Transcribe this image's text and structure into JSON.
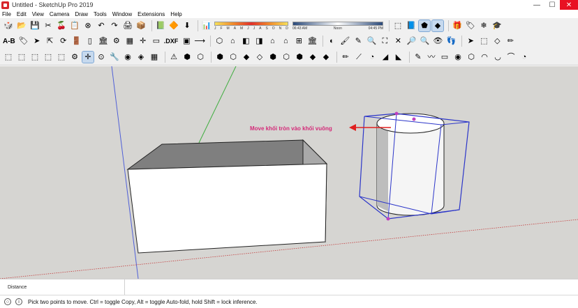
{
  "window": {
    "title": "Untitled - SketchUp Pro 2019",
    "minimize": "—",
    "maximize": "☐",
    "close": "✕"
  },
  "menu": [
    "File",
    "Edit",
    "View",
    "Camera",
    "Draw",
    "Tools",
    "Window",
    "Extensions",
    "Help"
  ],
  "toolbar": {
    "row1": [
      "🎲",
      "📂",
      "💾",
      "✂",
      "🍒",
      "📋",
      "⊗",
      "↶",
      "↷",
      "🖨",
      "📦",
      "📗",
      "🔶",
      "⬇",
      "📊"
    ],
    "row1b": [
      "⬚",
      "📘",
      "⬟",
      "◆",
      "🎁",
      "🏷",
      "❄",
      "🎓"
    ],
    "shadow_months": [
      "J",
      "F",
      "M",
      "A",
      "M",
      "J",
      "J",
      "A",
      "S",
      "O",
      "N",
      "D"
    ],
    "shadow_times": [
      "06:43 AM",
      "Noon",
      "04:45 PM"
    ],
    "row2_text": "A-B",
    "row2": [
      "🏷",
      "➤",
      "⇱",
      "⟳",
      "🚪",
      "▯",
      "🏛",
      "⚙",
      "▦",
      "✛",
      "▭"
    ],
    "dxf": ".DXF",
    "row2b": [
      "▣",
      "⟶",
      "⬡",
      "⌂",
      "◧",
      "◨",
      "⌂",
      "⌂",
      "⊞",
      "🏛",
      "◐",
      "🖌",
      "✎",
      "🔍",
      "⛶",
      "✕",
      "🔎",
      "🔍",
      "👁",
      "👣"
    ],
    "row2c": [
      "➤",
      "⬚",
      "◇",
      "✏"
    ],
    "row3": [
      "⬚",
      "⬚",
      "⬚",
      "⬚",
      "⬚",
      "⚙",
      "✛",
      "⊙",
      "🔧",
      "◉",
      "◈",
      "▦",
      "⚠",
      "⬢",
      "⬡",
      "⬢",
      "⬡",
      "◆",
      "◇",
      "⬢",
      "⬡",
      "⬢",
      "◆",
      "◆"
    ],
    "row3b": [
      "✏",
      "⟋",
      "◔",
      "◢",
      "◣",
      "✎",
      "〰",
      "▭",
      "◉",
      "⬡",
      "◠",
      "◡",
      "⌒",
      "◔",
      "◑",
      "◕",
      "▰",
      "◆",
      "⬟",
      "⬠",
      "◆",
      "✕",
      "⬟"
    ]
  },
  "viewport": {
    "annotation": "Move khối tròn vào khối vuông",
    "colors": {
      "background": "#d6d5d2",
      "box_front": "#ffffff",
      "box_top": "#7f7f7f",
      "box_side": "#a9a9a9",
      "selection": "#2b35c9",
      "annotation": "#d42a78",
      "axis_red": "#c43b3b",
      "axis_green": "#3fae3f",
      "axis_blue": "#5060d8"
    }
  },
  "measurements": {
    "label": "Distance"
  },
  "status": {
    "text": "Pick two points to move.  Ctrl = toggle Copy, Alt = toggle Auto-fold, hold Shift = lock inference."
  }
}
